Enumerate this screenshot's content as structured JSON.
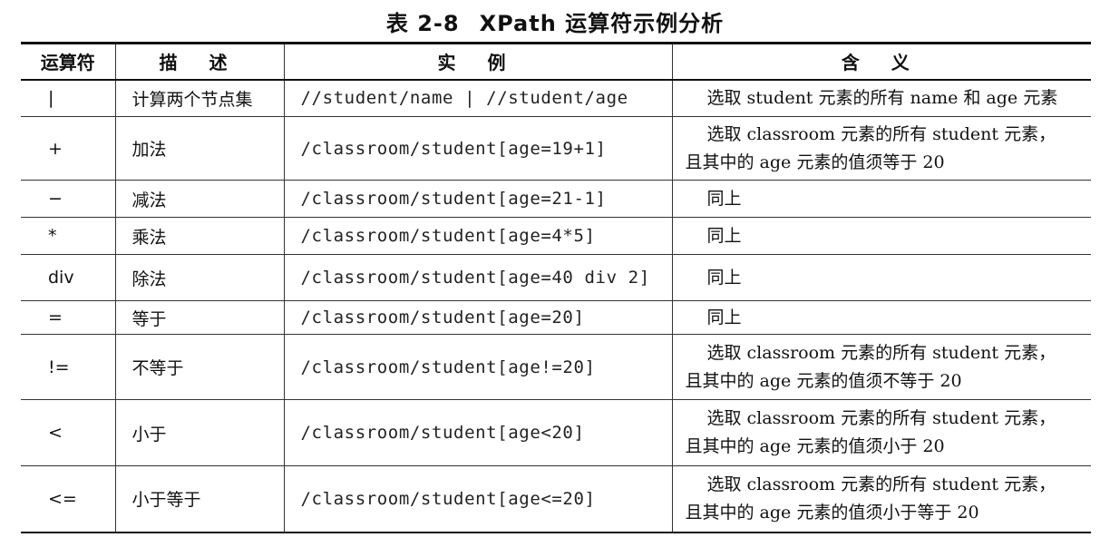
{
  "caption": {
    "number": "表 2-8",
    "title": "XPath 运算符示例分析"
  },
  "table": {
    "headers": [
      "运算符",
      "描 述",
      "实 例",
      "含 义"
    ],
    "rows": [
      {
        "operator": "|",
        "description": "计算两个节点集",
        "example": "//student/name | //student/age",
        "meaning": [
          "选取 student 元素的所有 name 和 age 元素"
        ]
      },
      {
        "operator": "+",
        "description": "加法",
        "example": "/classroom/student[age=19+1]",
        "meaning": [
          "选取 classroom 元素的所有 student 元素，",
          "且其中的 age 元素的值须等于 20"
        ]
      },
      {
        "operator": "−",
        "description": "减法",
        "example": "/classroom/student[age=21-1]",
        "meaning": [
          "同上"
        ]
      },
      {
        "operator": "*",
        "description": "乘法",
        "example": "/classroom/student[age=4*5]",
        "meaning": [
          "同上"
        ]
      },
      {
        "operator": "div",
        "description": "除法",
        "example": "/classroom/student[age=40  div 2]",
        "meaning": [
          "同上"
        ]
      },
      {
        "operator": "=",
        "description": "等于",
        "example": "/classroom/student[age=20]",
        "meaning": [
          "同上"
        ]
      },
      {
        "operator": "!=",
        "description": "不等于",
        "example": "/classroom/student[age!=20]",
        "meaning": [
          "选取 classroom 元素的所有 student 元素，",
          "且其中的 age 元素的值须不等于 20"
        ]
      },
      {
        "operator": "<",
        "description": "小于",
        "example": "/classroom/student[age<20]",
        "meaning": [
          "选取 classroom 元素的所有 student 元素，",
          "且其中的 age 元素的值须小于 20"
        ]
      },
      {
        "operator": "<=",
        "description": "小于等于",
        "example": "/classroom/student[age<=20]",
        "meaning": [
          "选取 classroom 元素的所有 student 元素，",
          "且其中的 age 元素的值须小于等于 20"
        ]
      }
    ]
  }
}
